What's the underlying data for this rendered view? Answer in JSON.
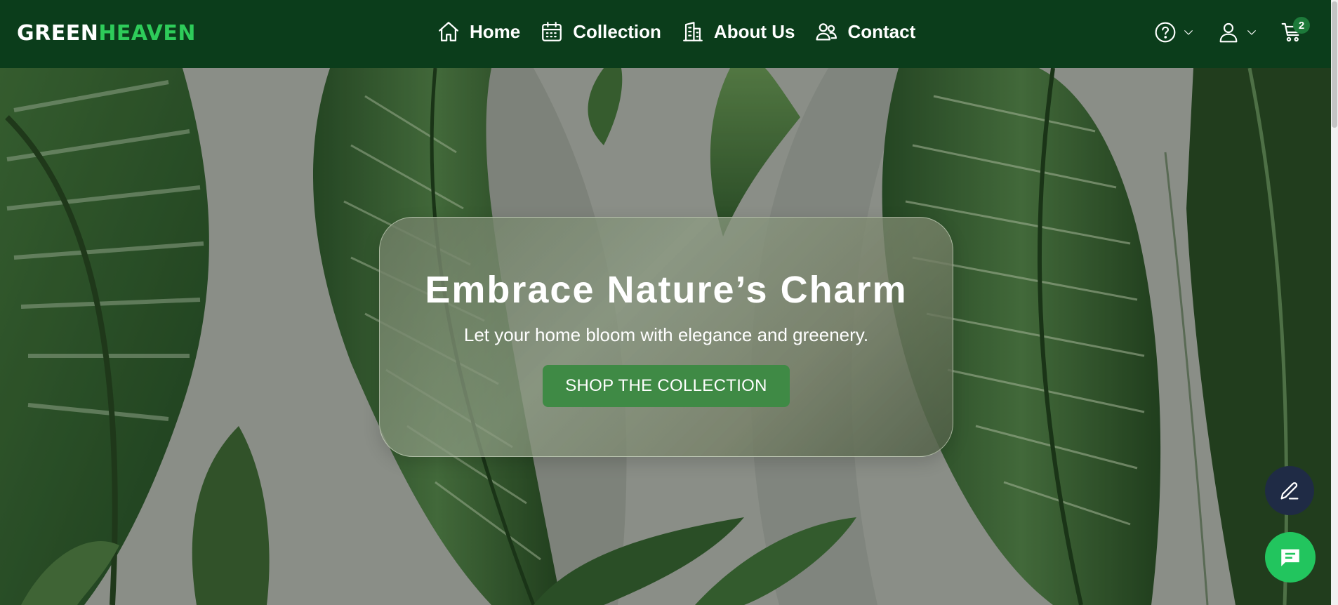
{
  "brand": {
    "part1": "GREEN",
    "part2": "HEAVEN"
  },
  "nav": {
    "items": [
      {
        "label": "Home",
        "icon": "home-icon"
      },
      {
        "label": "Collection",
        "icon": "calendar-icon"
      },
      {
        "label": "About Us",
        "icon": "building-icon"
      },
      {
        "label": "Contact",
        "icon": "users-icon"
      }
    ]
  },
  "tools": {
    "help_icon": "help-circle-icon",
    "account_icon": "user-icon",
    "cart_icon": "cart-icon",
    "cart_count": "2"
  },
  "hero": {
    "title": "Embrace Nature’s Charm",
    "subtitle": "Let your home bloom with elegance and greenery.",
    "cta_label": "SHOP THE COLLECTION"
  },
  "fabs": {
    "edit_icon": "pen-icon",
    "chat_icon": "chat-bubble-icon"
  },
  "colors": {
    "navbar": "#0b3d1b",
    "brand_accent": "#2ecc5a",
    "cta": "#3f8a45",
    "chat_fab": "#22c55e",
    "edit_fab": "#1f2b45"
  }
}
